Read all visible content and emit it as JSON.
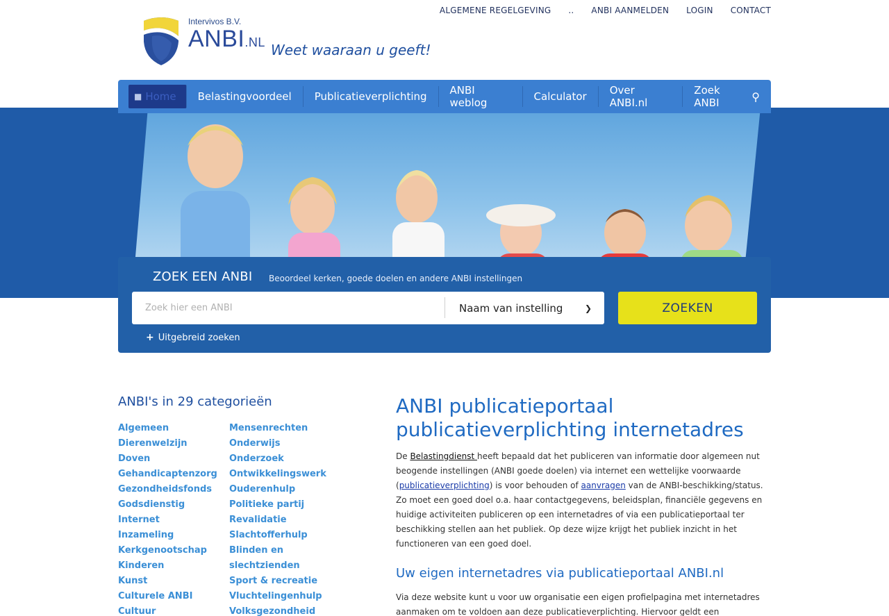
{
  "toplinks": [
    {
      "label": "ALGEMENE REGELGEVING"
    },
    {
      "label": ".."
    },
    {
      "label": "ANBI AANMELDEN"
    },
    {
      "label": "LOGIN"
    },
    {
      "label": "CONTACT"
    }
  ],
  "logo": {
    "sub": "Intervivos B.V.",
    "main": "ANBI",
    "suffix": ".NL",
    "tagline": "Weet waaraan u geeft!"
  },
  "nav": [
    {
      "label": "Home",
      "icon": "home-icon",
      "active": true
    },
    {
      "label": "Belastingvoordeel"
    },
    {
      "label": "Publicatieverplichting"
    },
    {
      "label": "ANBI weblog"
    },
    {
      "label": "Calculator"
    },
    {
      "label": "Over ANBI.nl"
    },
    {
      "label": "Zoek ANBI",
      "icon": "search-icon"
    }
  ],
  "search": {
    "title": "ZOEK EEN ANBI",
    "subtitle": "Beoordeel kerken, goede doelen en andere ANBI instellingen",
    "placeholder": "Zoek hier een ANBI",
    "select_value": "Naam van instelling",
    "button": "ZOEKEN",
    "advanced": "Uitgebreid zoeken"
  },
  "categories": {
    "title": "ANBI's in 29 categorieën",
    "col1": [
      "Algemeen",
      "Dierenwelzijn",
      "Doven",
      "Gehandicaptenzorg",
      "Gezondheidsfonds",
      "Godsdienstig",
      "Internet",
      "Inzameling",
      "Kerkgenootschap",
      "Kinderen",
      "Kunst",
      "Culturele ANBI",
      "Cultuur"
    ],
    "col2": [
      "Mensenrechten",
      "Onderwijs",
      "Onderzoek",
      "Ontwikkelingswerk",
      "Ouderenhulp",
      "Politieke partij",
      "Revalidatie",
      "Slachtofferhulp",
      "Blinden en",
      "slechtzienden",
      "Sport & recreatie",
      "Vluchtelingenhulp",
      "Volksgezondheid"
    ]
  },
  "main": {
    "title": "ANBI publicatieportaal publicatieverplichting internetadres",
    "p1_a": "De ",
    "p1_link1": "Belastingdienst ",
    "p1_b": "heeft bepaald dat het publiceren van informatie door algemeen nut beogende instellingen (ANBI goede doelen) via internet een wettelijke voorwaarde (",
    "p1_link2": "publicatieverplichting",
    "p1_c": ") is voor behouden of ",
    "p1_link3": "aanvragen",
    "p1_d": " van de ANBI-beschikking/status. Zo moet een goed doel o.a. haar contactgegevens, beleidsplan, financiële gegevens en huidige activiteiten publiceren op een internetadres of via een publicatieportaal ter beschikking stellen aan het publiek. Op deze wijze krijgt het publiek inzicht in het functioneren van een goed doel.",
    "subtitle": "Uw eigen internetadres via publicatieportaal ANBI.nl",
    "p2": "Via deze website kunt u voor uw organisatie een eigen profielpagina met internetadres aanmaken om te voldoen aan deze publicatieverplichting. Hiervoor geldt een"
  },
  "colors": {
    "nav": "#3b7fd1",
    "hero": "#1f5ba8",
    "button": "#e7e11a",
    "link": "#3b8fd6"
  }
}
